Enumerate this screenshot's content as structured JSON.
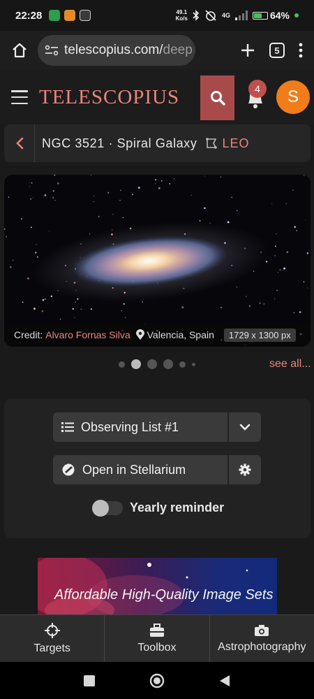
{
  "status_bar": {
    "time": "22:28",
    "net_speed_value": "49.1",
    "net_speed_unit": "Ko/s",
    "network": "4G",
    "battery_percent": "64%",
    "battery_level": 0.64
  },
  "browser": {
    "url_main": "telescopius.com/",
    "url_faded": "deep",
    "tab_count": "5"
  },
  "header": {
    "logo": "TELESCOPIUS",
    "notification_count": "4",
    "avatar_letter": "S"
  },
  "breadcrumb": {
    "title": "NGC 3521 · Spiral Galaxy",
    "constellation": "LEO"
  },
  "image": {
    "credit_label": "Credit:",
    "credit_name": "Alvaro Fornas Silva",
    "location": "Valencia, Spain",
    "dimensions": "1729 x 1300 px"
  },
  "carousel": {
    "see_all": "see all..."
  },
  "actions": {
    "observing_list": "Observing List #1",
    "stellarium": "Open in Stellarium",
    "reminder": "Yearly reminder",
    "reminder_on": false
  },
  "ad": {
    "text": "Affordable High-Quality Image Sets"
  },
  "bottom_nav": {
    "targets": "Targets",
    "toolbox": "Toolbox",
    "astrophotography": "Astrophotography"
  },
  "colors": {
    "accent": "#e9847a",
    "search_bg": "#a84a4a",
    "avatar_bg": "#f07d1a"
  }
}
